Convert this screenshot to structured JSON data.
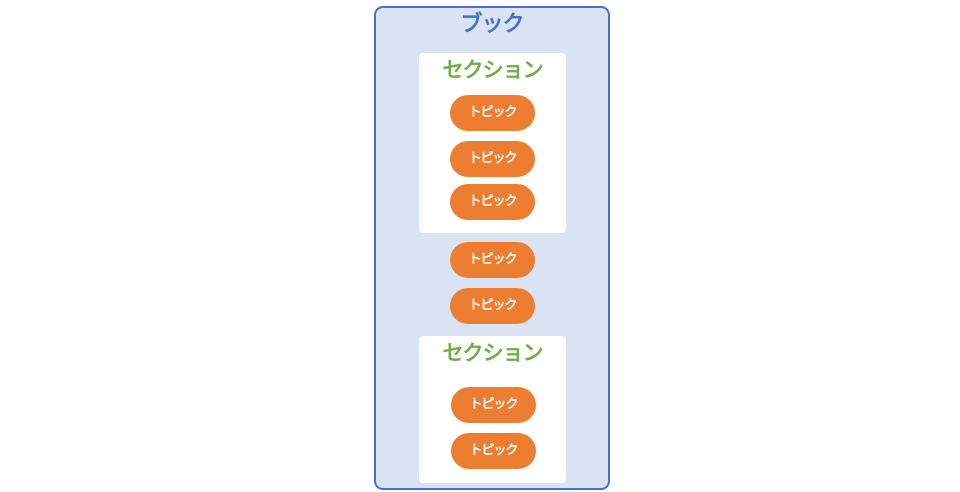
{
  "book": {
    "title": "ブック",
    "sections": [
      {
        "title": "セクション",
        "topics": [
          "トピック",
          "トピック",
          "トピック"
        ]
      },
      {
        "title": "セクション",
        "topics": [
          "トピック",
          "トピック"
        ]
      }
    ],
    "loose_topics": [
      "トピック",
      "トピック"
    ]
  },
  "colors": {
    "book_fill": "#dae3f3",
    "book_border": "#4472c4",
    "section_fill": "#ffffff",
    "section_title": "#70ad47",
    "topic_fill": "#ed7d31",
    "topic_text": "#ffffff"
  }
}
